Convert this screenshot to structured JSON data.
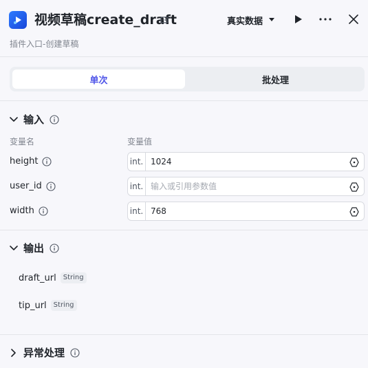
{
  "header": {
    "title": "视频草稿create_draft",
    "mode_label": "真实数据",
    "subtitle": "插件入口-创建草稿"
  },
  "tabs": [
    {
      "label": "单次",
      "active": true
    },
    {
      "label": "批处理",
      "active": false
    }
  ],
  "input_section": {
    "title": "输入",
    "col_name": "变量名",
    "col_value": "变量值",
    "params": [
      {
        "name": "height",
        "type": "int.",
        "value": "1024",
        "placeholder": ""
      },
      {
        "name": "user_id",
        "type": "int.",
        "value": "",
        "placeholder": "输入或引用参数值"
      },
      {
        "name": "width",
        "type": "int.",
        "value": "768",
        "placeholder": ""
      }
    ]
  },
  "output_section": {
    "title": "输出",
    "items": [
      {
        "name": "draft_url",
        "type": "String"
      },
      {
        "name": "tip_url",
        "type": "String"
      }
    ]
  },
  "exception_section": {
    "title": "异常处理"
  },
  "colors": {
    "accent": "#4d53e8",
    "brand": "#2f7bff"
  }
}
